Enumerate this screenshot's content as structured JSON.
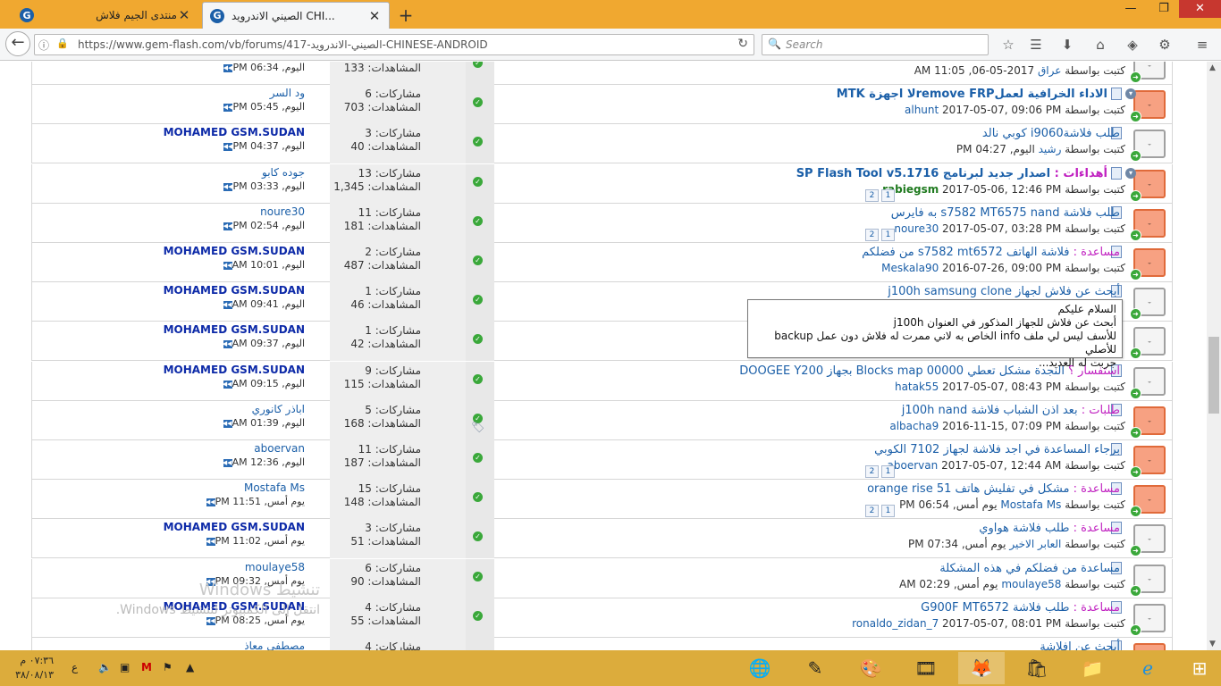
{
  "browser": {
    "tabs": [
      {
        "title": "منتدى الجيم فلاش",
        "active": false
      },
      {
        "title": "الصيني الاندرويد CHI...",
        "active": true
      }
    ],
    "favicon_letter": "G",
    "new_tab_symbol": "+",
    "url": "https://www.gem-flash.com/vb/forums/417-الصيني-الاندرويد-CHINESE-ANDROID",
    "search_placeholder": "Search",
    "window_controls": {
      "minimize": "—",
      "restore": "❐",
      "close": "✕"
    }
  },
  "threads": [
    {
      "title": "",
      "prefix": "",
      "author": "عراق",
      "date": "2017-05-06, 11:05 AM",
      "replies": "مشاركات: ",
      "views": "المشاهدات: 133",
      "last_poster": "",
      "last_time": "اليوم, 06:34 PM",
      "hot": false,
      "bold": false
    },
    {
      "title": "الاداء الخرافية لعملremove FRPلا اجهزة MTK",
      "prefix": "",
      "author": "alhunt",
      "date": "2017-05-07, 09:06 PM",
      "replies": "مشاركات: 6",
      "views": "المشاهدات: 703",
      "last_poster": "ود السر",
      "last_time": "اليوم, 05:45 PM",
      "hot": true,
      "bold": true
    },
    {
      "title": "طلب فلاشةi9060 كوبي نالد",
      "prefix": "",
      "author": "رشيد",
      "date": "اليوم, 04:27 PM",
      "replies": "مشاركات: 3",
      "views": "المشاهدات: 40",
      "last_poster": "MOHAMED GSM.SUDAN",
      "last_time": "اليوم, 04:37 PM",
      "hot": false,
      "bold": false
    },
    {
      "title": "اصدار جديد لبرنامج SP Flash Tool v5.1716",
      "prefix": "أهداءات : ",
      "author": "rabiegsm",
      "date": "2017-05-06, 12:46 PM",
      "replies": "مشاركات: 13",
      "views": "المشاهدات: 1,345",
      "last_poster": "جوده كابو",
      "last_time": "اليوم, 03:33 PM",
      "hot": true,
      "bold": true,
      "pages": [
        "1",
        "2"
      ]
    },
    {
      "title": "طلب فلاشة s7582 MT6575 nand به فايرس",
      "prefix": "",
      "author": "noure30",
      "date": "2017-05-07, 03:28 PM",
      "replies": "مشاركات: 11",
      "views": "المشاهدات: 181",
      "last_poster": "noure30",
      "last_time": "اليوم, 02:54 PM",
      "hot": true,
      "bold": false,
      "pages": [
        "1",
        "2"
      ]
    },
    {
      "title": "فلاشة الهاتف s7582 mt6572 من فضلكم",
      "prefix": "مساعدة : ",
      "author": "Meskala90",
      "date": "2016-07-26, 09:00 PM",
      "replies": "مشاركات: 2",
      "views": "المشاهدات: 487",
      "last_poster": "MOHAMED GSM.SUDAN",
      "last_time": "اليوم, 10:01 AM",
      "hot": true,
      "bold": false
    },
    {
      "title": "أبحث عن فلاش لجهاز j100h samsung clone",
      "prefix": "",
      "author": "",
      "date": "",
      "replies": "مشاركات: 1",
      "views": "المشاهدات: 46",
      "last_poster": "MOHAMED GSM.SUDAN",
      "last_time": "اليوم, 09:41 AM",
      "hot": false,
      "bold": false
    },
    {
      "title": "",
      "prefix": "",
      "author": "",
      "date": "",
      "replies": "مشاركات: 1",
      "views": "المشاهدات: 42",
      "last_poster": "MOHAMED GSM.SUDAN",
      "last_time": "اليوم, 09:37 AM",
      "hot": false,
      "bold": false
    },
    {
      "title": "النجدة مشكل تعطي Blocks map 00000 بجهاز DOOGEE Y200",
      "prefix": "استفسار ؟ ",
      "author": "hatak55",
      "date": "2017-05-07, 08:43 PM",
      "replies": "مشاركات: 9",
      "views": "المشاهدات: 115",
      "last_poster": "MOHAMED GSM.SUDAN",
      "last_time": "اليوم, 09:15 AM",
      "hot": false,
      "bold": false
    },
    {
      "title": "بعد اذن الشباب فلاشة j100h nand",
      "prefix": "طلبات : ",
      "author": "albacha9",
      "date": "2016-11-15, 07:09 PM",
      "replies": "مشاركات: 5",
      "views": "المشاهدات: 168",
      "last_poster": "اباذر كانوري",
      "last_time": "اليوم, 01:39 AM",
      "hot": true,
      "bold": false,
      "tag": true
    },
    {
      "title": "برجاء المساعدة في اجد فلاشة لجهاز 7102 الكوبي",
      "prefix": "",
      "author": "aboervan",
      "date": "2017-05-07, 12:44 AM",
      "replies": "مشاركات: 11",
      "views": "المشاهدات: 187",
      "last_poster": "aboervan",
      "last_time": "اليوم, 12:36 AM",
      "hot": true,
      "bold": false,
      "pages": [
        "1",
        "2"
      ]
    },
    {
      "title": "مشكل في تفليش هاتف orange rise 51",
      "prefix": "مساعدة : ",
      "author": "Mostafa Ms",
      "date": "يوم أمس, 06:54 PM",
      "replies": "مشاركات: 15",
      "views": "المشاهدات: 148",
      "last_poster": "Mostafa Ms",
      "last_time": "يوم أمس, 11:51 PM",
      "hot": true,
      "bold": false,
      "pages": [
        "1",
        "2"
      ]
    },
    {
      "title": "طلب فلاشة هواوي",
      "prefix": "مساعدة : ",
      "author": "العابر الاخير",
      "date": "يوم أمس, 07:34 PM",
      "replies": "مشاركات: 3",
      "views": "المشاهدات: 51",
      "last_poster": "MOHAMED GSM.SUDAN",
      "last_time": "يوم أمس, 11:02 PM",
      "hot": false,
      "bold": false
    },
    {
      "title": "مساعدة من فضلكم في هذه المشكلة",
      "prefix": "",
      "author": "moulaye58",
      "date": "يوم أمس, 02:29 AM",
      "replies": "مشاركات: 6",
      "views": "المشاهدات: 90",
      "last_poster": "moulaye58",
      "last_time": "يوم أمس, 09:32 PM",
      "hot": false,
      "bold": false
    },
    {
      "title": "طلب فلاشة G900F MT6572",
      "prefix": "مساعدة : ",
      "author": "ronaldo_zidan_7",
      "date": "2017-05-07, 08:01 PM",
      "replies": "مشاركات: 4",
      "views": "المشاهدات: 55",
      "last_poster": "MOHAMED GSM.SUDAN",
      "last_time": "يوم أمس, 08:25 PM",
      "hot": false,
      "bold": false
    },
    {
      "title": "أبحث عن افلاشة",
      "prefix": "",
      "author": "",
      "date": "",
      "replies": "مشاركات: 4",
      "views": "",
      "last_poster": "مصطفى معاذ",
      "last_time": "",
      "hot": true,
      "bold": false
    }
  ],
  "by_label": "كتبت بواسطة",
  "tooltip": {
    "line1": "السلام عليكم",
    "line2": "أبحث عن فلاش للجهاز المذكور في العنوان j100h",
    "line3": "للأسف ليس لي ملف info الخاص به لاني ممرت له فلاش دون عمل backup للأصلي",
    "line4": "جربت له العديد..."
  },
  "watermark": {
    "line1": "تنشيط Windows",
    "line2": "انتقل إلى الكمبيوتر لتنشيط Windows."
  },
  "taskbar": {
    "clock_time": "٠٧:٣٦ م",
    "clock_date": "٣٨/٠٨/١٣",
    "lang": "ع"
  },
  "colors": {
    "tabbar": "#f0a830",
    "taskbar": "#dcac3c",
    "link": "#1b5fa8",
    "prefix": "#c020c0",
    "hot_icon": "#f7a182"
  }
}
